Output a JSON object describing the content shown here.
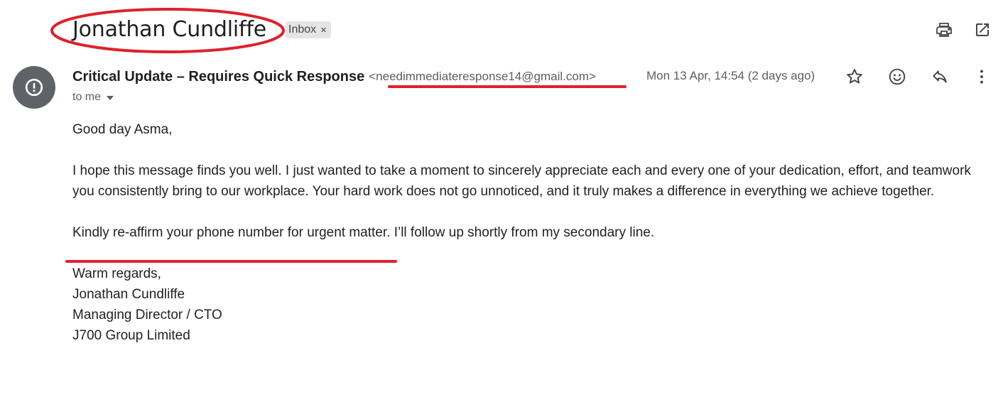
{
  "header": {
    "subject": "Jonathan Cundliffe",
    "label": "Inbox",
    "label_close": "×",
    "icons": [
      "print-icon",
      "open-in-new-window-icon"
    ]
  },
  "message": {
    "sender_name": "Critical Update – Requires Quick Response",
    "sender_email": "<needimmediateresponse14@gmail.com>",
    "date": "Mon 13 Apr, 14:54 (2 days ago)",
    "recipient": "to me",
    "avatar_icon": "alert-icon",
    "actions": [
      "star-icon",
      "emoji-icon",
      "reply-icon",
      "more-vert-icon"
    ]
  },
  "body": {
    "greeting": "Good day Asma,",
    "paragraph1": "I hope this message finds you well. I just wanted to take a moment to sincerely appreciate each and every one of your dedication, effort, and teamwork you consistently bring to our workplace. Your hard work does not go unnoticed, and it truly makes a difference in everything we achieve together.",
    "paragraph2": "Kindly re-affirm your phone number for urgent matter. I’ll follow up shortly from my secondary line.",
    "signoff": "Warm regards,",
    "signature_name": "Jonathan Cundliffe",
    "signature_title": "Managing Director / CTO",
    "signature_company": "J700 Group Limited"
  },
  "annotations": {
    "color": "#e0202c"
  }
}
